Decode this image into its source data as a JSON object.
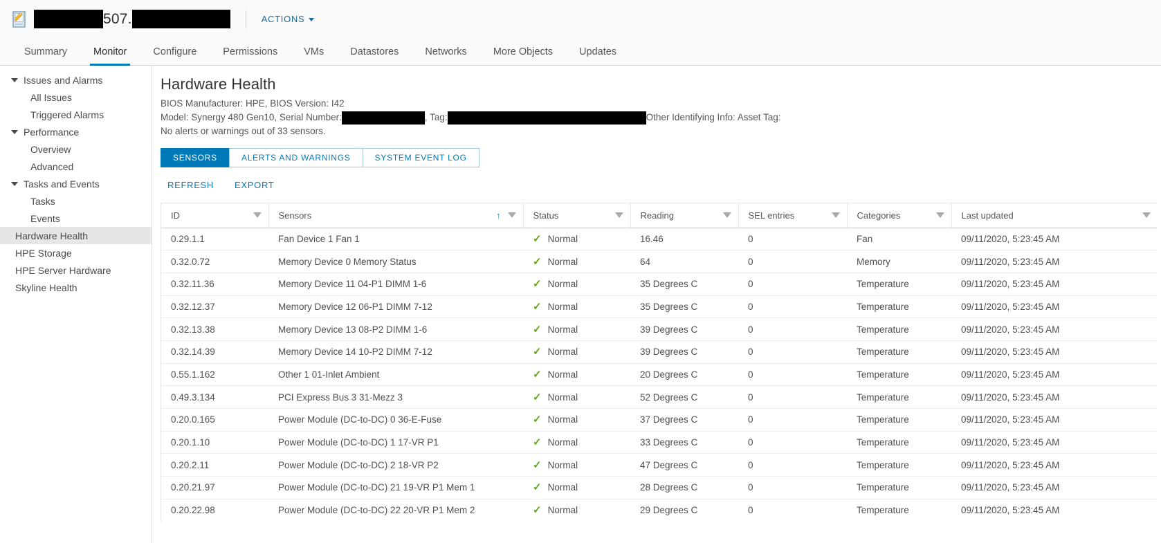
{
  "header": {
    "object_icon": "host-icon",
    "title_visible_text": "507.",
    "redacted_prefix": true,
    "redacted_suffix": true,
    "actions_label": "ACTIONS",
    "actions_caret": "chevron-down-icon"
  },
  "tabs": [
    {
      "label": "Summary",
      "active": false
    },
    {
      "label": "Monitor",
      "active": true
    },
    {
      "label": "Configure",
      "active": false
    },
    {
      "label": "Permissions",
      "active": false
    },
    {
      "label": "VMs",
      "active": false
    },
    {
      "label": "Datastores",
      "active": false
    },
    {
      "label": "Networks",
      "active": false
    },
    {
      "label": "More Objects",
      "active": false
    },
    {
      "label": "Updates",
      "active": false
    }
  ],
  "sidebar": {
    "items": [
      {
        "label": "Issues and Alarms",
        "type": "group",
        "selected": false
      },
      {
        "label": "All Issues",
        "type": "child",
        "selected": false
      },
      {
        "label": "Triggered Alarms",
        "type": "child",
        "selected": false
      },
      {
        "label": "Performance",
        "type": "group",
        "selected": false
      },
      {
        "label": "Overview",
        "type": "child",
        "selected": false
      },
      {
        "label": "Advanced",
        "type": "child",
        "selected": false
      },
      {
        "label": "Tasks and Events",
        "type": "group",
        "selected": false
      },
      {
        "label": "Tasks",
        "type": "child",
        "selected": false
      },
      {
        "label": "Events",
        "type": "child",
        "selected": false
      },
      {
        "label": "Hardware Health",
        "type": "leaf",
        "selected": true
      },
      {
        "label": "HPE Storage",
        "type": "leaf",
        "selected": false
      },
      {
        "label": "HPE Server Hardware",
        "type": "leaf",
        "selected": false
      },
      {
        "label": "Skyline Health",
        "type": "leaf",
        "selected": false
      }
    ]
  },
  "main": {
    "page_title": "Hardware Health",
    "bios_line": "BIOS Manufacturer: HPE, BIOS Version: I42",
    "model_prefix": "Model: Synergy 480 Gen10, Serial Number:",
    "tag_prefix": ", Tag:",
    "other_info": "Other Identifying Info: Asset Tag:",
    "alerts_summary": "No alerts or warnings out of 33 sensors.",
    "subtabs": [
      {
        "label": "SENSORS",
        "active": true
      },
      {
        "label": "ALERTS AND WARNINGS",
        "active": false
      },
      {
        "label": "SYSTEM EVENT LOG",
        "active": false
      }
    ],
    "actions": [
      {
        "label": "REFRESH"
      },
      {
        "label": "EXPORT"
      }
    ]
  },
  "table": {
    "columns": [
      {
        "key": "id",
        "label": "ID",
        "sorted": false,
        "filter": true
      },
      {
        "key": "sensors",
        "label": "Sensors",
        "sorted": "asc",
        "filter": true
      },
      {
        "key": "status",
        "label": "Status",
        "sorted": false,
        "filter": true
      },
      {
        "key": "reading",
        "label": "Reading",
        "sorted": false,
        "filter": true
      },
      {
        "key": "sel",
        "label": "SEL entries",
        "sorted": false,
        "filter": true
      },
      {
        "key": "categories",
        "label": "Categories",
        "sorted": false,
        "filter": true
      },
      {
        "key": "updated",
        "label": "Last updated",
        "sorted": false,
        "filter": true
      }
    ],
    "status_icon": "check-icon",
    "rows": [
      {
        "id": "0.29.1.1",
        "sensors": "Fan Device 1 Fan 1",
        "status": "Normal",
        "reading": "16.46",
        "sel": "0",
        "categories": "Fan",
        "updated": "09/11/2020, 5:23:45 AM"
      },
      {
        "id": "0.32.0.72",
        "sensors": "Memory Device 0 Memory Status",
        "status": "Normal",
        "reading": "64",
        "sel": "0",
        "categories": "Memory",
        "updated": "09/11/2020, 5:23:45 AM"
      },
      {
        "id": "0.32.11.36",
        "sensors": "Memory Device 11 04-P1 DIMM 1-6",
        "status": "Normal",
        "reading": "35 Degrees C",
        "sel": "0",
        "categories": "Temperature",
        "updated": "09/11/2020, 5:23:45 AM"
      },
      {
        "id": "0.32.12.37",
        "sensors": "Memory Device 12 06-P1 DIMM 7-12",
        "status": "Normal",
        "reading": "35 Degrees C",
        "sel": "0",
        "categories": "Temperature",
        "updated": "09/11/2020, 5:23:45 AM"
      },
      {
        "id": "0.32.13.38",
        "sensors": "Memory Device 13 08-P2 DIMM 1-6",
        "status": "Normal",
        "reading": "39 Degrees C",
        "sel": "0",
        "categories": "Temperature",
        "updated": "09/11/2020, 5:23:45 AM"
      },
      {
        "id": "0.32.14.39",
        "sensors": "Memory Device 14 10-P2 DIMM 7-12",
        "status": "Normal",
        "reading": "39 Degrees C",
        "sel": "0",
        "categories": "Temperature",
        "updated": "09/11/2020, 5:23:45 AM"
      },
      {
        "id": "0.55.1.162",
        "sensors": "Other 1 01-Inlet Ambient",
        "status": "Normal",
        "reading": "20 Degrees C",
        "sel": "0",
        "categories": "Temperature",
        "updated": "09/11/2020, 5:23:45 AM"
      },
      {
        "id": "0.49.3.134",
        "sensors": "PCI Express Bus 3 31-Mezz 3",
        "status": "Normal",
        "reading": "52 Degrees C",
        "sel": "0",
        "categories": "Temperature",
        "updated": "09/11/2020, 5:23:45 AM"
      },
      {
        "id": "0.20.0.165",
        "sensors": "Power Module (DC-to-DC) 0 36-E-Fuse",
        "status": "Normal",
        "reading": "37 Degrees C",
        "sel": "0",
        "categories": "Temperature",
        "updated": "09/11/2020, 5:23:45 AM"
      },
      {
        "id": "0.20.1.10",
        "sensors": "Power Module (DC-to-DC) 1 17-VR P1",
        "status": "Normal",
        "reading": "33 Degrees C",
        "sel": "0",
        "categories": "Temperature",
        "updated": "09/11/2020, 5:23:45 AM"
      },
      {
        "id": "0.20.2.11",
        "sensors": "Power Module (DC-to-DC) 2 18-VR P2",
        "status": "Normal",
        "reading": "47 Degrees C",
        "sel": "0",
        "categories": "Temperature",
        "updated": "09/11/2020, 5:23:45 AM"
      },
      {
        "id": "0.20.21.97",
        "sensors": "Power Module (DC-to-DC) 21 19-VR P1 Mem 1",
        "status": "Normal",
        "reading": "28 Degrees C",
        "sel": "0",
        "categories": "Temperature",
        "updated": "09/11/2020, 5:23:45 AM"
      },
      {
        "id": "0.20.22.98",
        "sensors": "Power Module (DC-to-DC) 22 20-VR P1 Mem 2",
        "status": "Normal",
        "reading": "29 Degrees C",
        "sel": "0",
        "categories": "Temperature",
        "updated": "09/11/2020, 5:23:45 AM"
      }
    ]
  },
  "colors": {
    "accent": "#0079b8",
    "link": "#1b6a9f",
    "status_ok": "#60a917",
    "selected_row": "#e6e6e6"
  }
}
